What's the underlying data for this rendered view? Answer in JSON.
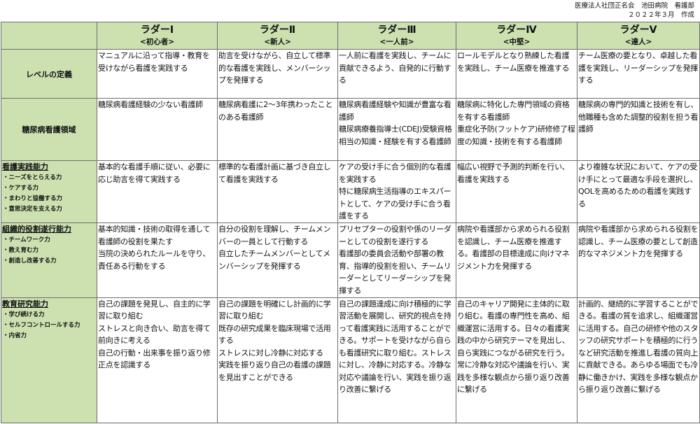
{
  "header": {
    "organization": "医療法人社団正名会　池田病院　看護部",
    "date": "２０２２年３月　作成"
  },
  "ladders": [
    {
      "name": "ラダーⅠ",
      "label": "<初心者>"
    },
    {
      "name": "ラダーⅡ",
      "label": "<新人>"
    },
    {
      "name": "ラダーⅢ",
      "label": "<一人前>"
    },
    {
      "name": "ラダーⅣ",
      "label": "<中堅>"
    },
    {
      "name": "ラダーⅤ",
      "label": "<達人>"
    }
  ],
  "rows": {
    "level": {
      "title": "レベルの定義",
      "cells": [
        [
          "マニュアルに沿って指導・教育を受けながら看護を実践する"
        ],
        [
          "助言を受けながら、自立して標準的な看護を実践し、メンバーシップを発揮する"
        ],
        [
          "一人前に看護を実践し、チームに貢献できるよう、自発的に行動する"
        ],
        [
          "ロールモデルとなり熟練した看護を実践し、チーム医療を推進する"
        ],
        [
          "チーム医療の要となり、卓越した看護を実践し、リーダーシップを発揮する"
        ]
      ]
    },
    "diabetes": {
      "title": "糖尿病看護領域",
      "cells": [
        [
          "糖尿病看護経験の少ない看護師"
        ],
        [
          "糖尿病看護に2～3年携わったことのある看護師"
        ],
        [
          "糖尿病看護経験や知識が豊富な看護師",
          "糖尿病療養指導士(CDEJ)受験資格相当の知識・経験を有する看護師"
        ],
        [
          "糖尿病に特化した専門領域の資格を有する看護師",
          "重症化予防(フットケア)研修修了程度の知識・技術を有する看護師"
        ],
        [
          "糖尿病の専門的知識と技術を有し、他職種も含めた調整的役割を担う看護師"
        ]
      ]
    },
    "practice": {
      "title": "看護実践能力",
      "subs": [
        "・ニーズをとらえる力",
        "・ケアする力",
        "・まわりと協働する力",
        "・意思決定を支える力"
      ],
      "cells": [
        [
          "基本的な看護手順に従い、必要に応じ助言を得て実践する"
        ],
        [
          "標準的な看護計画に基づき自立して看護を実践する"
        ],
        [
          "ケアの受け手に合う個別的な看護を実践する",
          "特に糖尿病生活指導のエキスパートとして、ケアの受け手に合う看護をする"
        ],
        [
          "幅広い視野で予測的判断を行い、看護を実践する"
        ],
        [
          "より複雑な状況において、ケアの受け手にとって最適な手段を選択し、QOLを高めるための看護を実践する"
        ]
      ]
    },
    "organization": {
      "title": "組織的役割遂行能力",
      "subs": [
        "・チームワーク力",
        "・教え育む力",
        "・創造し改善する力"
      ],
      "cells": [
        [
          "基本的知識・技術の取得を通して看護師の役割を果たす",
          "当院の決められたルールを守り、責任ある行動をする"
        ],
        [
          "自分の役割を理解し、チームメンバーの一員として行動する",
          "自立したチームメンバーとしてメンバーシップを発揮する"
        ],
        [
          "プリセプターの役割や係のリーダーとしての役割を遂行する",
          "看護部の委員会活動や部署の教育、指導的役割を担い、チームリーダーとしてリーダーシップを発揮する"
        ],
        [
          "病院や看護部から求められる役割を認識し、チーム医療を推進する。看護部の目標達成に向けマネジメント力を発揮する"
        ],
        [
          "病院や看護部から求められる役割を認識し、チーム医療の要として創造的なマネジメント力を発揮する"
        ]
      ]
    },
    "education": {
      "title": "教育研究能力",
      "subs": [
        "・学び続ける力",
        "・セルフコントロールする力",
        "・内省力"
      ],
      "cells": [
        [
          "自己の課題を発見し、自主的に学習に取り組む",
          "ストレスと向き合い、助言を得て前向きに考える",
          "自己の行動・出来事を振り返り修正点を認識する"
        ],
        [
          "自己の課題を明確にし計画的に学習に取り組む",
          "既存の研究成果を臨床現場で活用する",
          "ストレスに対し冷静に対応する",
          "実践を振り返り自己の看護の課題を見出すことができる"
        ],
        [
          "自己の課題達成に向け積極的に学習活動を展開し、研究的視点を持って看護実践に活用することができる。サポートを受けながら自らも看護研究に取り組む。ストレスに対し、冷静に対応する。冷静な対応や議論を行い、実践を振り返り改善に繋げる"
        ],
        [
          "自己のキャリア開発に主体的に取り組む。看護の専門性を高め、組織運営に活用する。日々の看護実践の中から研究テーマを見出し、自ら実践につながる研究を行う。常に冷静な対応や議論を行い、実践を多様な観点から振り返り改善に繋げる"
        ],
        [
          "計画的、継続的に学習することができる。看護の質を追求し、組織運営に活用する。自己の研修や他のスタッフの研究サポートを積極的に行うなど研究活動を推進し看護の質向上に貢献できる。あらゆる場面でも冷静に働きかけ、実践を多様な観点から振り返り改善に繋げる"
        ]
      ]
    }
  }
}
